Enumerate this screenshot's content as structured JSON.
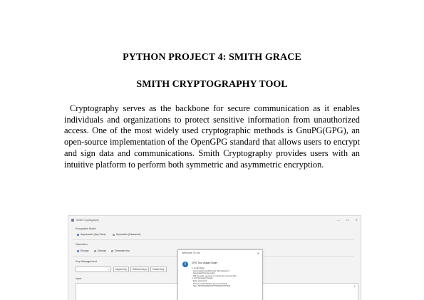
{
  "document": {
    "heading": "PYTHON PROJECT 4: SMITH GRACE",
    "subheading": "SMITH CRYPTOGRAPHY TOOL",
    "body": "Cryptography serves as the backbone for secure communication as it enables individuals and organizations to protect sensitive information from unauthorized access. One of the most widely used cryptographic methods is GnuPG(GPG), an open-source implementation of the OpenGPG standard that allows users to encrypt and sign data and communications. Smith Cryptography provides users with an intuitive platform to perform both symmetric and asymmetric encryption."
  },
  "screenshot": {
    "window_title": "Smith Cryptography",
    "window_controls": [
      "—",
      "☐",
      "✕"
    ],
    "encryption_mode": {
      "label": "Encryption Mode",
      "options": [
        "Asymmetric (Key Pairs)",
        "Symmetric (Password)"
      ],
      "selected": "Asymmetric (Key Pairs)"
    },
    "operation": {
      "label": "Operation",
      "options": [
        "Encrypt",
        "Decrypt",
        "Generate Key"
      ],
      "selected": "Encrypt"
    },
    "key_management": {
      "label": "Key Management",
      "combo_value": "",
      "buttons": [
        "Import Key",
        "Refresh Keys",
        "Delete Key"
      ]
    },
    "input": {
      "label": "Input",
      "value": ""
    },
    "dialog": {
      "title": "Welcome To Gui",
      "heading": "GPG Tool Usage Guide:",
      "lines": [
        "1. Local Mode:",
        "  - Generate/Encrypt/Decrypt with password",
        "  - Generate/Trust key pairs",
        "  - Will use gpg --gen-key to create the new key files",
        "",
        "2. For Symmetric Mode:",
        "  - Enter password",
        "  - Choose cipher/Output (recommended)",
        "  - Type TRUSTED/ENCRYPT/DECRYPTED"
      ],
      "accent": "#1d6fd1"
    }
  }
}
